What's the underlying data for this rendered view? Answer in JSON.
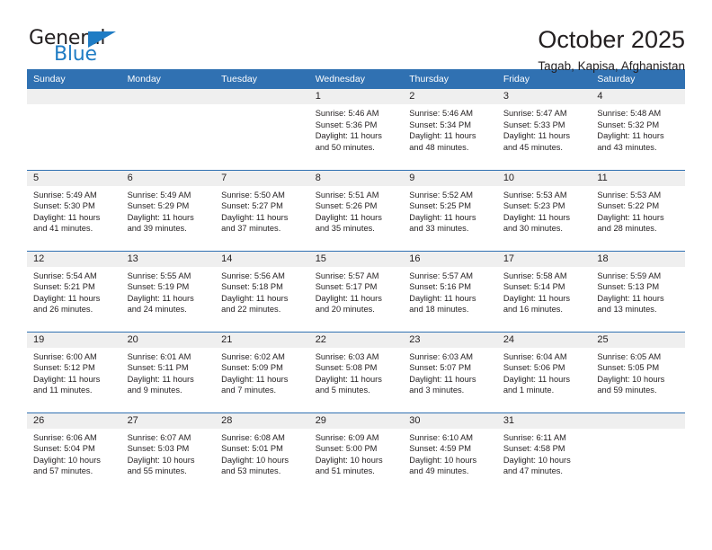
{
  "brand": {
    "name_top": "General",
    "name_bottom": "Blue",
    "accent_color": "#1f7cc4",
    "triangle_icon": "brand-triangle-icon"
  },
  "header": {
    "title": "October 2025",
    "subtitle": "Tagab, Kapisa, Afghanistan"
  },
  "colors": {
    "header_blue": "#3071b2",
    "daynum_band": "#efefef",
    "text": "#231f20"
  },
  "weekday_headers": [
    "Sunday",
    "Monday",
    "Tuesday",
    "Wednesday",
    "Thursday",
    "Friday",
    "Saturday"
  ],
  "weeks": [
    [
      {
        "day": "",
        "sunrise": "",
        "sunset": "",
        "daylight_1": "",
        "daylight_2": ""
      },
      {
        "day": "",
        "sunrise": "",
        "sunset": "",
        "daylight_1": "",
        "daylight_2": ""
      },
      {
        "day": "",
        "sunrise": "",
        "sunset": "",
        "daylight_1": "",
        "daylight_2": ""
      },
      {
        "day": "1",
        "sunrise": "Sunrise: 5:46 AM",
        "sunset": "Sunset: 5:36 PM",
        "daylight_1": "Daylight: 11 hours",
        "daylight_2": "and 50 minutes."
      },
      {
        "day": "2",
        "sunrise": "Sunrise: 5:46 AM",
        "sunset": "Sunset: 5:34 PM",
        "daylight_1": "Daylight: 11 hours",
        "daylight_2": "and 48 minutes."
      },
      {
        "day": "3",
        "sunrise": "Sunrise: 5:47 AM",
        "sunset": "Sunset: 5:33 PM",
        "daylight_1": "Daylight: 11 hours",
        "daylight_2": "and 45 minutes."
      },
      {
        "day": "4",
        "sunrise": "Sunrise: 5:48 AM",
        "sunset": "Sunset: 5:32 PM",
        "daylight_1": "Daylight: 11 hours",
        "daylight_2": "and 43 minutes."
      }
    ],
    [
      {
        "day": "5",
        "sunrise": "Sunrise: 5:49 AM",
        "sunset": "Sunset: 5:30 PM",
        "daylight_1": "Daylight: 11 hours",
        "daylight_2": "and 41 minutes."
      },
      {
        "day": "6",
        "sunrise": "Sunrise: 5:49 AM",
        "sunset": "Sunset: 5:29 PM",
        "daylight_1": "Daylight: 11 hours",
        "daylight_2": "and 39 minutes."
      },
      {
        "day": "7",
        "sunrise": "Sunrise: 5:50 AM",
        "sunset": "Sunset: 5:27 PM",
        "daylight_1": "Daylight: 11 hours",
        "daylight_2": "and 37 minutes."
      },
      {
        "day": "8",
        "sunrise": "Sunrise: 5:51 AM",
        "sunset": "Sunset: 5:26 PM",
        "daylight_1": "Daylight: 11 hours",
        "daylight_2": "and 35 minutes."
      },
      {
        "day": "9",
        "sunrise": "Sunrise: 5:52 AM",
        "sunset": "Sunset: 5:25 PM",
        "daylight_1": "Daylight: 11 hours",
        "daylight_2": "and 33 minutes."
      },
      {
        "day": "10",
        "sunrise": "Sunrise: 5:53 AM",
        "sunset": "Sunset: 5:23 PM",
        "daylight_1": "Daylight: 11 hours",
        "daylight_2": "and 30 minutes."
      },
      {
        "day": "11",
        "sunrise": "Sunrise: 5:53 AM",
        "sunset": "Sunset: 5:22 PM",
        "daylight_1": "Daylight: 11 hours",
        "daylight_2": "and 28 minutes."
      }
    ],
    [
      {
        "day": "12",
        "sunrise": "Sunrise: 5:54 AM",
        "sunset": "Sunset: 5:21 PM",
        "daylight_1": "Daylight: 11 hours",
        "daylight_2": "and 26 minutes."
      },
      {
        "day": "13",
        "sunrise": "Sunrise: 5:55 AM",
        "sunset": "Sunset: 5:19 PM",
        "daylight_1": "Daylight: 11 hours",
        "daylight_2": "and 24 minutes."
      },
      {
        "day": "14",
        "sunrise": "Sunrise: 5:56 AM",
        "sunset": "Sunset: 5:18 PM",
        "daylight_1": "Daylight: 11 hours",
        "daylight_2": "and 22 minutes."
      },
      {
        "day": "15",
        "sunrise": "Sunrise: 5:57 AM",
        "sunset": "Sunset: 5:17 PM",
        "daylight_1": "Daylight: 11 hours",
        "daylight_2": "and 20 minutes."
      },
      {
        "day": "16",
        "sunrise": "Sunrise: 5:57 AM",
        "sunset": "Sunset: 5:16 PM",
        "daylight_1": "Daylight: 11 hours",
        "daylight_2": "and 18 minutes."
      },
      {
        "day": "17",
        "sunrise": "Sunrise: 5:58 AM",
        "sunset": "Sunset: 5:14 PM",
        "daylight_1": "Daylight: 11 hours",
        "daylight_2": "and 16 minutes."
      },
      {
        "day": "18",
        "sunrise": "Sunrise: 5:59 AM",
        "sunset": "Sunset: 5:13 PM",
        "daylight_1": "Daylight: 11 hours",
        "daylight_2": "and 13 minutes."
      }
    ],
    [
      {
        "day": "19",
        "sunrise": "Sunrise: 6:00 AM",
        "sunset": "Sunset: 5:12 PM",
        "daylight_1": "Daylight: 11 hours",
        "daylight_2": "and 11 minutes."
      },
      {
        "day": "20",
        "sunrise": "Sunrise: 6:01 AM",
        "sunset": "Sunset: 5:11 PM",
        "daylight_1": "Daylight: 11 hours",
        "daylight_2": "and 9 minutes."
      },
      {
        "day": "21",
        "sunrise": "Sunrise: 6:02 AM",
        "sunset": "Sunset: 5:09 PM",
        "daylight_1": "Daylight: 11 hours",
        "daylight_2": "and 7 minutes."
      },
      {
        "day": "22",
        "sunrise": "Sunrise: 6:03 AM",
        "sunset": "Sunset: 5:08 PM",
        "daylight_1": "Daylight: 11 hours",
        "daylight_2": "and 5 minutes."
      },
      {
        "day": "23",
        "sunrise": "Sunrise: 6:03 AM",
        "sunset": "Sunset: 5:07 PM",
        "daylight_1": "Daylight: 11 hours",
        "daylight_2": "and 3 minutes."
      },
      {
        "day": "24",
        "sunrise": "Sunrise: 6:04 AM",
        "sunset": "Sunset: 5:06 PM",
        "daylight_1": "Daylight: 11 hours",
        "daylight_2": "and 1 minute."
      },
      {
        "day": "25",
        "sunrise": "Sunrise: 6:05 AM",
        "sunset": "Sunset: 5:05 PM",
        "daylight_1": "Daylight: 10 hours",
        "daylight_2": "and 59 minutes."
      }
    ],
    [
      {
        "day": "26",
        "sunrise": "Sunrise: 6:06 AM",
        "sunset": "Sunset: 5:04 PM",
        "daylight_1": "Daylight: 10 hours",
        "daylight_2": "and 57 minutes."
      },
      {
        "day": "27",
        "sunrise": "Sunrise: 6:07 AM",
        "sunset": "Sunset: 5:03 PM",
        "daylight_1": "Daylight: 10 hours",
        "daylight_2": "and 55 minutes."
      },
      {
        "day": "28",
        "sunrise": "Sunrise: 6:08 AM",
        "sunset": "Sunset: 5:01 PM",
        "daylight_1": "Daylight: 10 hours",
        "daylight_2": "and 53 minutes."
      },
      {
        "day": "29",
        "sunrise": "Sunrise: 6:09 AM",
        "sunset": "Sunset: 5:00 PM",
        "daylight_1": "Daylight: 10 hours",
        "daylight_2": "and 51 minutes."
      },
      {
        "day": "30",
        "sunrise": "Sunrise: 6:10 AM",
        "sunset": "Sunset: 4:59 PM",
        "daylight_1": "Daylight: 10 hours",
        "daylight_2": "and 49 minutes."
      },
      {
        "day": "31",
        "sunrise": "Sunrise: 6:11 AM",
        "sunset": "Sunset: 4:58 PM",
        "daylight_1": "Daylight: 10 hours",
        "daylight_2": "and 47 minutes."
      },
      {
        "day": "",
        "sunrise": "",
        "sunset": "",
        "daylight_1": "",
        "daylight_2": ""
      }
    ]
  ]
}
